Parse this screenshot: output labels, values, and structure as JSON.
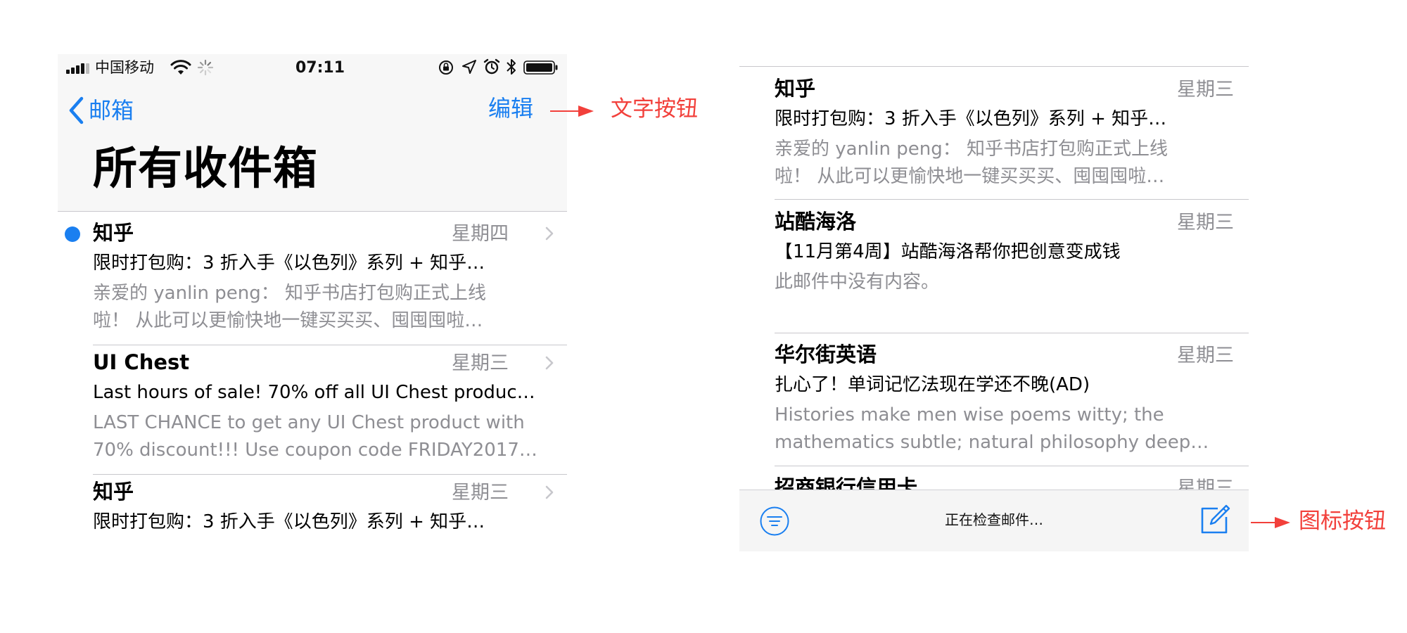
{
  "status_bar": {
    "carrier": "中国移动",
    "time": "07:11"
  },
  "nav": {
    "back_label": "邮箱",
    "edit_label": "编辑",
    "title": "所有收件箱"
  },
  "left_list": [
    {
      "sender": "知乎",
      "day": "星期四",
      "subject": "限时打包购：3 折入手《以色列》系列 + 知乎…",
      "preview": "亲爱的 yanlin peng： 知乎书店打包购正式上线\n啦！ 从此可以更愉快地一键买买买、囤囤囤啦…",
      "unread": true
    },
    {
      "sender": "UI Chest",
      "day": "星期三",
      "subject": "Last hours of sale! 70% off all UI Chest produc…",
      "preview": "LAST CHANCE to get any UI Chest product with\n70% discount!!! Use coupon code FRIDAY2017…",
      "unread": false
    },
    {
      "sender": "知乎",
      "day": "星期三",
      "subject": "限时打包购：3 折入手《以色列》系列 + 知乎…",
      "preview": "",
      "unread": false
    }
  ],
  "right_list": [
    {
      "sender": "知乎",
      "day": "星期三",
      "subject": "限时打包购：3 折入手《以色列》系列 + 知乎…",
      "preview": "亲爱的 yanlin peng： 知乎书店打包购正式上线\n啦！ 从此可以更愉快地一键买买买、囤囤囤啦…"
    },
    {
      "sender": "站酷海洛",
      "day": "星期三",
      "subject": "【11月第4周】站酷海洛帮你把创意变成钱",
      "preview": "此邮件中没有内容。"
    },
    {
      "sender": "华尔街英语",
      "day": "星期三",
      "subject": "扎心了！单词记忆法现在学还不晚(AD)",
      "preview": "Histories make men wise poems witty; the\nmathematics subtle; natural philosophy deep…"
    },
    {
      "sender": "招商银行信用卡",
      "day": "星期三",
      "subject": "",
      "preview": ""
    }
  ],
  "toolbar": {
    "status": "正在检查邮件…"
  },
  "annotations": {
    "text_button": "文字按钮",
    "icon_button": "图标按钮"
  },
  "colors": {
    "accent": "#1a7ff0",
    "annotation": "#f2403b",
    "secondary_text": "#8e8e93",
    "separator": "#c8c7cc"
  },
  "icons": {
    "back": "chevron-left-icon",
    "row": "chevron-right-icon",
    "filter": "filter-icon",
    "compose": "compose-icon"
  }
}
